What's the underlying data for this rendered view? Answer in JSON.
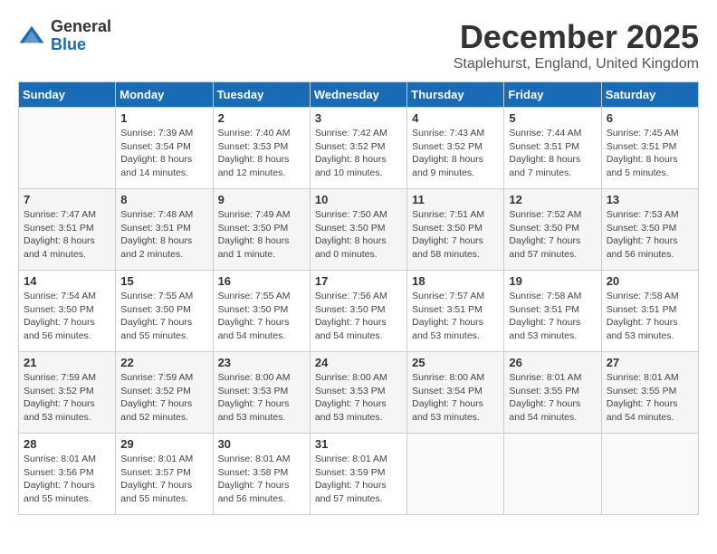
{
  "logo": {
    "general": "General",
    "blue": "Blue"
  },
  "title": "December 2025",
  "location": "Staplehurst, England, United Kingdom",
  "weekdays": [
    "Sunday",
    "Monday",
    "Tuesday",
    "Wednesday",
    "Thursday",
    "Friday",
    "Saturday"
  ],
  "weeks": [
    [
      {
        "day": "",
        "info": ""
      },
      {
        "day": "1",
        "info": "Sunrise: 7:39 AM\nSunset: 3:54 PM\nDaylight: 8 hours\nand 14 minutes."
      },
      {
        "day": "2",
        "info": "Sunrise: 7:40 AM\nSunset: 3:53 PM\nDaylight: 8 hours\nand 12 minutes."
      },
      {
        "day": "3",
        "info": "Sunrise: 7:42 AM\nSunset: 3:52 PM\nDaylight: 8 hours\nand 10 minutes."
      },
      {
        "day": "4",
        "info": "Sunrise: 7:43 AM\nSunset: 3:52 PM\nDaylight: 8 hours\nand 9 minutes."
      },
      {
        "day": "5",
        "info": "Sunrise: 7:44 AM\nSunset: 3:51 PM\nDaylight: 8 hours\nand 7 minutes."
      },
      {
        "day": "6",
        "info": "Sunrise: 7:45 AM\nSunset: 3:51 PM\nDaylight: 8 hours\nand 5 minutes."
      }
    ],
    [
      {
        "day": "7",
        "info": "Sunrise: 7:47 AM\nSunset: 3:51 PM\nDaylight: 8 hours\nand 4 minutes."
      },
      {
        "day": "8",
        "info": "Sunrise: 7:48 AM\nSunset: 3:51 PM\nDaylight: 8 hours\nand 2 minutes."
      },
      {
        "day": "9",
        "info": "Sunrise: 7:49 AM\nSunset: 3:50 PM\nDaylight: 8 hours\nand 1 minute."
      },
      {
        "day": "10",
        "info": "Sunrise: 7:50 AM\nSunset: 3:50 PM\nDaylight: 8 hours\nand 0 minutes."
      },
      {
        "day": "11",
        "info": "Sunrise: 7:51 AM\nSunset: 3:50 PM\nDaylight: 7 hours\nand 58 minutes."
      },
      {
        "day": "12",
        "info": "Sunrise: 7:52 AM\nSunset: 3:50 PM\nDaylight: 7 hours\nand 57 minutes."
      },
      {
        "day": "13",
        "info": "Sunrise: 7:53 AM\nSunset: 3:50 PM\nDaylight: 7 hours\nand 56 minutes."
      }
    ],
    [
      {
        "day": "14",
        "info": "Sunrise: 7:54 AM\nSunset: 3:50 PM\nDaylight: 7 hours\nand 56 minutes."
      },
      {
        "day": "15",
        "info": "Sunrise: 7:55 AM\nSunset: 3:50 PM\nDaylight: 7 hours\nand 55 minutes."
      },
      {
        "day": "16",
        "info": "Sunrise: 7:55 AM\nSunset: 3:50 PM\nDaylight: 7 hours\nand 54 minutes."
      },
      {
        "day": "17",
        "info": "Sunrise: 7:56 AM\nSunset: 3:50 PM\nDaylight: 7 hours\nand 54 minutes."
      },
      {
        "day": "18",
        "info": "Sunrise: 7:57 AM\nSunset: 3:51 PM\nDaylight: 7 hours\nand 53 minutes."
      },
      {
        "day": "19",
        "info": "Sunrise: 7:58 AM\nSunset: 3:51 PM\nDaylight: 7 hours\nand 53 minutes."
      },
      {
        "day": "20",
        "info": "Sunrise: 7:58 AM\nSunset: 3:51 PM\nDaylight: 7 hours\nand 53 minutes."
      }
    ],
    [
      {
        "day": "21",
        "info": "Sunrise: 7:59 AM\nSunset: 3:52 PM\nDaylight: 7 hours\nand 53 minutes."
      },
      {
        "day": "22",
        "info": "Sunrise: 7:59 AM\nSunset: 3:52 PM\nDaylight: 7 hours\nand 52 minutes."
      },
      {
        "day": "23",
        "info": "Sunrise: 8:00 AM\nSunset: 3:53 PM\nDaylight: 7 hours\nand 53 minutes."
      },
      {
        "day": "24",
        "info": "Sunrise: 8:00 AM\nSunset: 3:53 PM\nDaylight: 7 hours\nand 53 minutes."
      },
      {
        "day": "25",
        "info": "Sunrise: 8:00 AM\nSunset: 3:54 PM\nDaylight: 7 hours\nand 53 minutes."
      },
      {
        "day": "26",
        "info": "Sunrise: 8:01 AM\nSunset: 3:55 PM\nDaylight: 7 hours\nand 54 minutes."
      },
      {
        "day": "27",
        "info": "Sunrise: 8:01 AM\nSunset: 3:55 PM\nDaylight: 7 hours\nand 54 minutes."
      }
    ],
    [
      {
        "day": "28",
        "info": "Sunrise: 8:01 AM\nSunset: 3:56 PM\nDaylight: 7 hours\nand 55 minutes."
      },
      {
        "day": "29",
        "info": "Sunrise: 8:01 AM\nSunset: 3:57 PM\nDaylight: 7 hours\nand 55 minutes."
      },
      {
        "day": "30",
        "info": "Sunrise: 8:01 AM\nSunset: 3:58 PM\nDaylight: 7 hours\nand 56 minutes."
      },
      {
        "day": "31",
        "info": "Sunrise: 8:01 AM\nSunset: 3:59 PM\nDaylight: 7 hours\nand 57 minutes."
      },
      {
        "day": "",
        "info": ""
      },
      {
        "day": "",
        "info": ""
      },
      {
        "day": "",
        "info": ""
      }
    ]
  ]
}
